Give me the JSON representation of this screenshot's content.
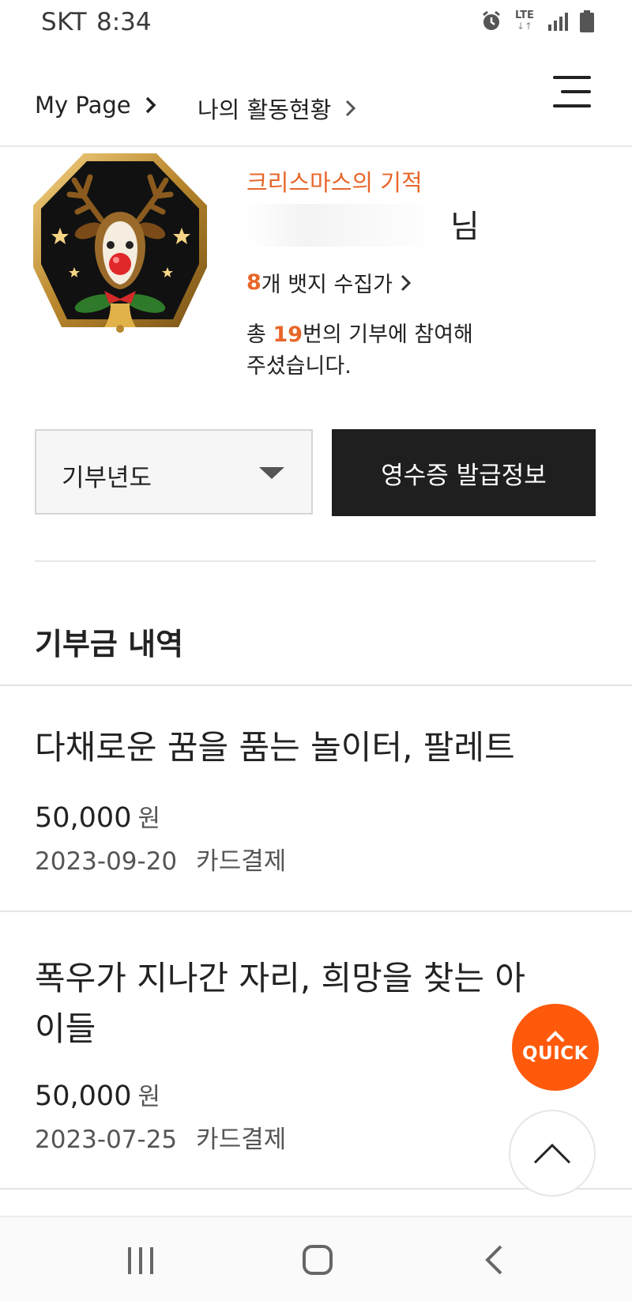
{
  "status_bar": {
    "carrier": "SKT",
    "time": "8:34",
    "network": "LTE"
  },
  "header": {
    "breadcrumb": [
      "My Page",
      "나의 활동현황"
    ]
  },
  "profile": {
    "badge_title": "크리스마스의 기적",
    "name_suffix": "님",
    "badge_count": "8",
    "badge_count_suffix": "개 뱃지 수집가",
    "donation_prefix": "총 ",
    "donation_count": "19",
    "donation_suffix": "번의 기부에 참여해",
    "donation_line2": "주셨습니다."
  },
  "controls": {
    "year_select": "기부년도",
    "receipt_button": "영수증 발급정보"
  },
  "section": {
    "title": "기부금 내역"
  },
  "donations": [
    {
      "title": "다채로운 꿈을 품는 놀이터, 팔레트",
      "amount": "50,000",
      "unit": "원",
      "date": "2023-09-20",
      "method": "카드결제"
    },
    {
      "title": "폭우가 지나간 자리, 희망을 찾는 아이들",
      "amount": "50,000",
      "unit": "원",
      "date": "2023-07-25",
      "method": "카드결제"
    }
  ],
  "floating": {
    "quick_label": "QUICK"
  },
  "colors": {
    "accent": "#e8662a",
    "quick": "#ff5a0c",
    "dark_button": "#1f1f1f"
  }
}
